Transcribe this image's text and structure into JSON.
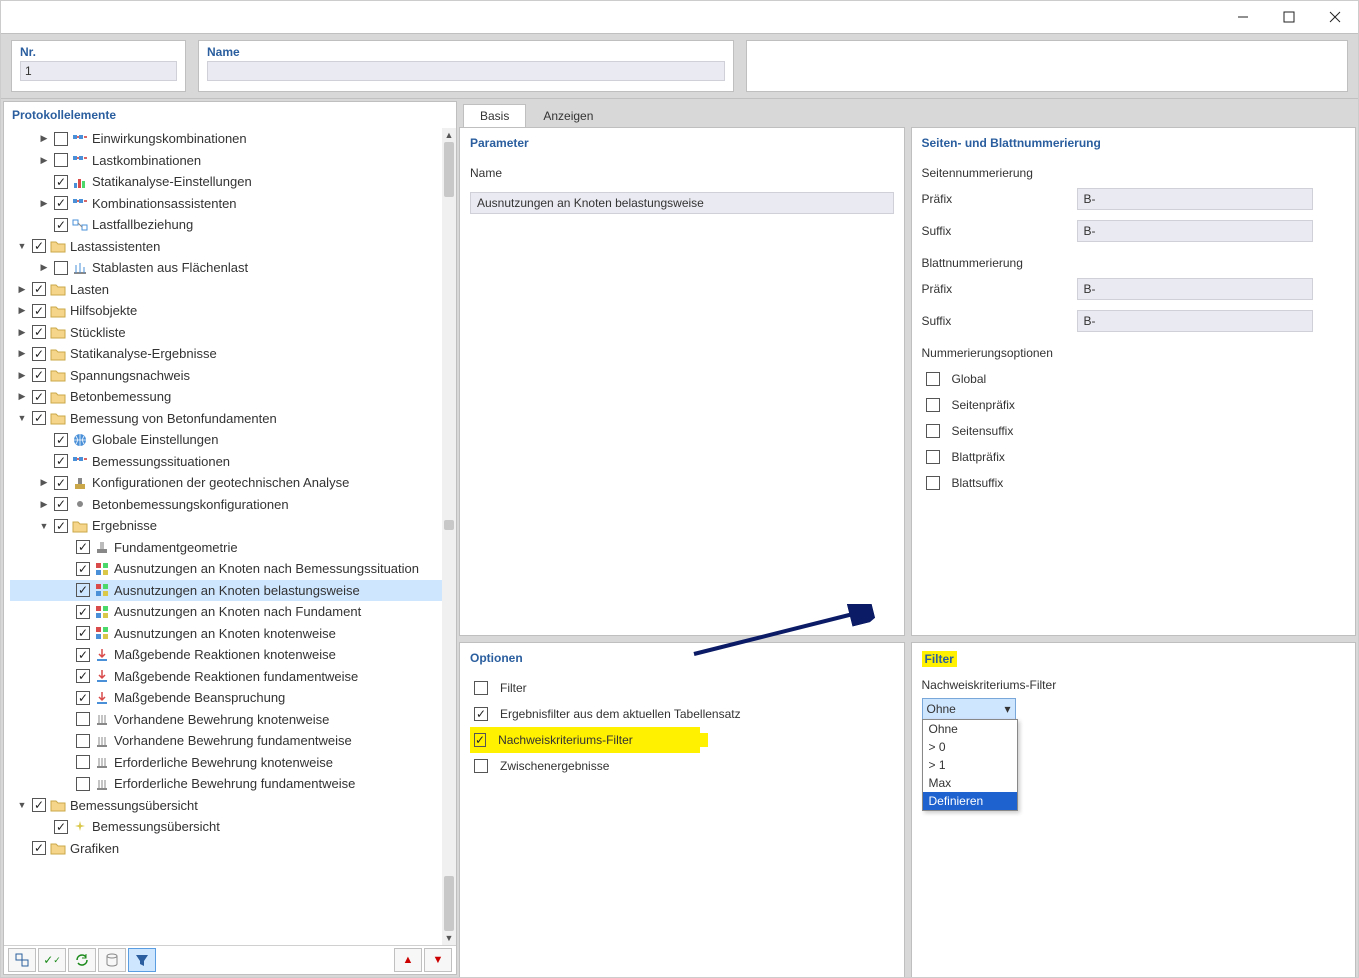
{
  "titlebar": {
    "minimize": "–",
    "maximize": "□",
    "close": "×"
  },
  "top": {
    "nr_label": "Nr.",
    "nr_value": "1",
    "name_label": "Name",
    "name_value": ""
  },
  "leftpanel": {
    "header": "Protokollelemente"
  },
  "tree": [
    {
      "d": 1,
      "e": ">",
      "c": 0,
      "i": "kombis",
      "t": "Einwirkungskombinationen"
    },
    {
      "d": 1,
      "e": ">",
      "c": 0,
      "i": "kombis",
      "t": "Lastkombinationen"
    },
    {
      "d": 1,
      "e": "",
      "c": 1,
      "i": "chart",
      "t": "Statikanalyse-Einstellungen"
    },
    {
      "d": 1,
      "e": ">",
      "c": 1,
      "i": "kombis",
      "t": "Kombinationsassistenten"
    },
    {
      "d": 1,
      "e": "",
      "c": 1,
      "i": "link",
      "t": "Lastfallbeziehung"
    },
    {
      "d": 0,
      "e": "v",
      "c": 1,
      "i": "folder",
      "t": "Lastassistenten"
    },
    {
      "d": 1,
      "e": ">",
      "c": 0,
      "i": "stab",
      "t": "Stablasten aus Flächenlast"
    },
    {
      "d": 0,
      "e": ">",
      "c": 1,
      "i": "folder",
      "t": "Lasten"
    },
    {
      "d": 0,
      "e": ">",
      "c": 1,
      "i": "folder",
      "t": "Hilfsobjekte"
    },
    {
      "d": 0,
      "e": ">",
      "c": 1,
      "i": "folder",
      "t": "Stückliste"
    },
    {
      "d": 0,
      "e": ">",
      "c": 1,
      "i": "folder",
      "t": "Statikanalyse-Ergebnisse"
    },
    {
      "d": 0,
      "e": ">",
      "c": 1,
      "i": "folder",
      "t": "Spannungsnachweis"
    },
    {
      "d": 0,
      "e": ">",
      "c": 1,
      "i": "folder",
      "t": "Betonbemessung"
    },
    {
      "d": 0,
      "e": "v",
      "c": 1,
      "i": "folder",
      "t": "Bemessung von Betonfundamenten"
    },
    {
      "d": 1,
      "e": "",
      "c": 1,
      "i": "globe",
      "t": "Globale Einstellungen"
    },
    {
      "d": 1,
      "e": "",
      "c": 1,
      "i": "kombis",
      "t": "Bemessungssituationen"
    },
    {
      "d": 1,
      "e": ">",
      "c": 1,
      "i": "geo",
      "t": "Konfigurationen der geotechnischen Analyse"
    },
    {
      "d": 1,
      "e": ">",
      "c": 1,
      "i": "dot",
      "t": "Betonbemessungskonfigurationen"
    },
    {
      "d": 1,
      "e": "v",
      "c": 1,
      "i": "folder",
      "t": "Ergebnisse"
    },
    {
      "d": 2,
      "e": "",
      "c": 1,
      "i": "fund",
      "t": "Fundamentgeometrie"
    },
    {
      "d": 2,
      "e": "",
      "c": 1,
      "i": "ausn",
      "t": "Ausnutzungen an Knoten nach Bemessungssituation"
    },
    {
      "d": 2,
      "e": "",
      "c": 1,
      "i": "ausn",
      "t": "Ausnutzungen an Knoten belastungsweise",
      "sel": true
    },
    {
      "d": 2,
      "e": "",
      "c": 1,
      "i": "ausn",
      "t": "Ausnutzungen an Knoten nach Fundament"
    },
    {
      "d": 2,
      "e": "",
      "c": 1,
      "i": "ausn",
      "t": "Ausnutzungen an Knoten knotenweise"
    },
    {
      "d": 2,
      "e": "",
      "c": 1,
      "i": "react",
      "t": "Maßgebende Reaktionen knotenweise"
    },
    {
      "d": 2,
      "e": "",
      "c": 1,
      "i": "react",
      "t": "Maßgebende Reaktionen fundamentweise"
    },
    {
      "d": 2,
      "e": "",
      "c": 1,
      "i": "react",
      "t": "Maßgebende Beanspruchung"
    },
    {
      "d": 2,
      "e": "",
      "c": 0,
      "i": "bew",
      "t": "Vorhandene Bewehrung knotenweise"
    },
    {
      "d": 2,
      "e": "",
      "c": 0,
      "i": "bew",
      "t": "Vorhandene Bewehrung fundamentweise"
    },
    {
      "d": 2,
      "e": "",
      "c": 0,
      "i": "bew",
      "t": "Erforderliche Bewehrung knotenweise"
    },
    {
      "d": 2,
      "e": "",
      "c": 0,
      "i": "bew",
      "t": "Erforderliche Bewehrung fundamentweise"
    },
    {
      "d": 0,
      "e": "v",
      "c": 1,
      "i": "folder",
      "t": "Bemessungsübersicht"
    },
    {
      "d": 1,
      "e": "",
      "c": 1,
      "i": "spark",
      "t": "Bemessungsübersicht"
    },
    {
      "d": 0,
      "e": "",
      "c": 1,
      "i": "folder",
      "t": "Grafiken"
    }
  ],
  "tabs": {
    "basis": "Basis",
    "anzeigen": "Anzeigen"
  },
  "paneA": {
    "title": "Parameter",
    "name_label": "Name",
    "name_value": "Ausnutzungen an Knoten belastungsweise"
  },
  "paneB": {
    "title": "Seiten- und Blattnummerierung",
    "seiten": "Seitennummerierung",
    "blatt": "Blattnummerierung",
    "prefix": "Präfix",
    "suffix": "Suffix",
    "b": "B-",
    "optheader": "Nummerierungsoptionen",
    "opts": [
      "Global",
      "Seitenpräfix",
      "Seitensuffix",
      "Blattpräfix",
      "Blattsuffix"
    ]
  },
  "paneC": {
    "title": "Optionen",
    "items": [
      {
        "c": 0,
        "t": "Filter",
        "hl": 0
      },
      {
        "c": 1,
        "t": "Ergebnisfilter aus dem aktuellen Tabellensatz",
        "hl": 0
      },
      {
        "c": 1,
        "t": "Nachweiskriteriums-Filter",
        "hl": 1
      },
      {
        "c": 0,
        "t": "Zwischenergebnisse",
        "hl": 0
      }
    ]
  },
  "paneD": {
    "title": "Filter",
    "label": "Nachweiskriteriums-Filter",
    "selected": "Ohne",
    "options": [
      "Ohne",
      "> 0",
      "> 1",
      "Max",
      "Definieren"
    ]
  }
}
